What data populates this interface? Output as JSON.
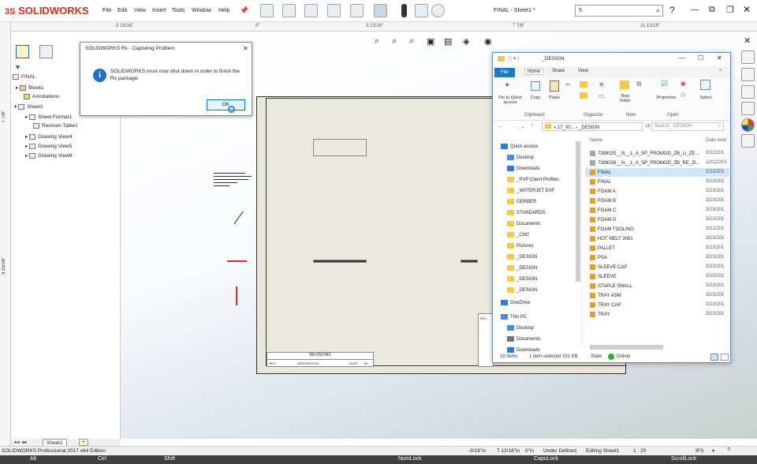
{
  "app": {
    "brand": "SOLIDWORKS",
    "doc_title": "FINAL - Sheet1 *",
    "search_text": "5"
  },
  "menu": [
    "File",
    "Edit",
    "View",
    "Insert",
    "Tools",
    "Window",
    "Help"
  ],
  "ruler": {
    "top_labels": [
      "-3 15/16\"",
      "0\"",
      "3 15/16\"",
      "7 7/8\"",
      "11 13/16\""
    ],
    "left_labels": [
      "7 7/8\"",
      "3 15/16\""
    ]
  },
  "tree": {
    "root": "FINAL",
    "items": [
      "Blocks",
      "Annotations",
      "Sheet1",
      "Sheet Format1",
      "Revision Table1",
      "Drawing View4",
      "Drawing View5",
      "Drawing View6"
    ]
  },
  "sheet": {
    "revisions_title": "REVISIONS",
    "rev_cols": [
      "REV.",
      "DESCRIPTION",
      "DATE",
      "BY"
    ],
    "rev_label": "REV."
  },
  "sheet_tabs": {
    "active": "Sheet1"
  },
  "dialog": {
    "title": "SOLIDWORKS Rx - Capturing Problem",
    "message": "SOLIDWORKS must now shut down in order to finish the Rx package.",
    "ok": "OK"
  },
  "explorer": {
    "title": "_DESIGN",
    "tabs": [
      "File",
      "Home",
      "Share",
      "View"
    ],
    "ribbon": {
      "pin": "Pin to Quick access",
      "copy": "Copy",
      "paste": "Paste",
      "new_folder": "New folder",
      "properties": "Properties",
      "select": "Select",
      "groups": [
        "Clipboard",
        "Organize",
        "New",
        "Open"
      ]
    },
    "address": "« 17_00... › _DESIGN",
    "search_placeholder": "Search _DESIGN",
    "column_name": "Name",
    "column_date": "Date mod",
    "nav": [
      "Quick access",
      "Desktop",
      "Downloads",
      "_PVP Client Profiles",
      "_WATERJET DXF",
      "GERBER",
      "STANDARDS",
      "Documents",
      "_CNC",
      "Pictures",
      "_DESIGN",
      "_DESIGN",
      "_DESIGN",
      "_DESIGN",
      "OneDrive",
      "This PC",
      "Desktop",
      "Documents",
      "Downloads"
    ],
    "files": [
      {
        "name": "7399025__N__1_A_SP_FROMOD_ZB_LI_ZE...",
        "date": "3/22/201"
      },
      {
        "name": "7399026__N__1_A_SP_FROMOD_ZB_RE_ZI...",
        "date": "12/12/201"
      },
      {
        "name": "FINAL",
        "date": "3/23/201"
      },
      {
        "name": "FINAL",
        "date": "3/23/201"
      },
      {
        "name": "FOAM A",
        "date": "3/23/201"
      },
      {
        "name": "FOAM B",
        "date": "3/23/201"
      },
      {
        "name": "FOAM C",
        "date": "3/23/201"
      },
      {
        "name": "FOAM D",
        "date": "3/23/201"
      },
      {
        "name": "FOAM TOOLING",
        "date": "3/21/201"
      },
      {
        "name": "HOT MELT 3081",
        "date": "3/23/201"
      },
      {
        "name": "PALLET",
        "date": "3/23/201"
      },
      {
        "name": "PSA",
        "date": "3/23/201"
      },
      {
        "name": "SLEEVE CAP",
        "date": "3/23/201"
      },
      {
        "name": "SLEEVE",
        "date": "3/25/201"
      },
      {
        "name": "STAPLE SMALL",
        "date": "3/23/201"
      },
      {
        "name": "TRAY ASM",
        "date": "3/23/201"
      },
      {
        "name": "TRAY CAP",
        "date": "3/23/201"
      },
      {
        "name": "TRAY",
        "date": "3/23/201"
      }
    ],
    "status": {
      "count": "18 items",
      "selected": "1 item selected  331 KB",
      "state": "State:",
      "online": "Online"
    }
  },
  "statusbar": {
    "edition": "SOLIDWORKS Professional 2017 x64 Edition",
    "x": "-9/16\"in",
    "y": "7 13/16\"in",
    "z": "0\"in",
    "defined": "Under Defined",
    "editing": "Editing Sheet1",
    "scale": "1 : 20",
    "units": "IPS"
  },
  "keys": [
    "Alt",
    "Ctrl",
    "Shift",
    "NumLock",
    "CapsLock",
    "ScrollLock"
  ]
}
